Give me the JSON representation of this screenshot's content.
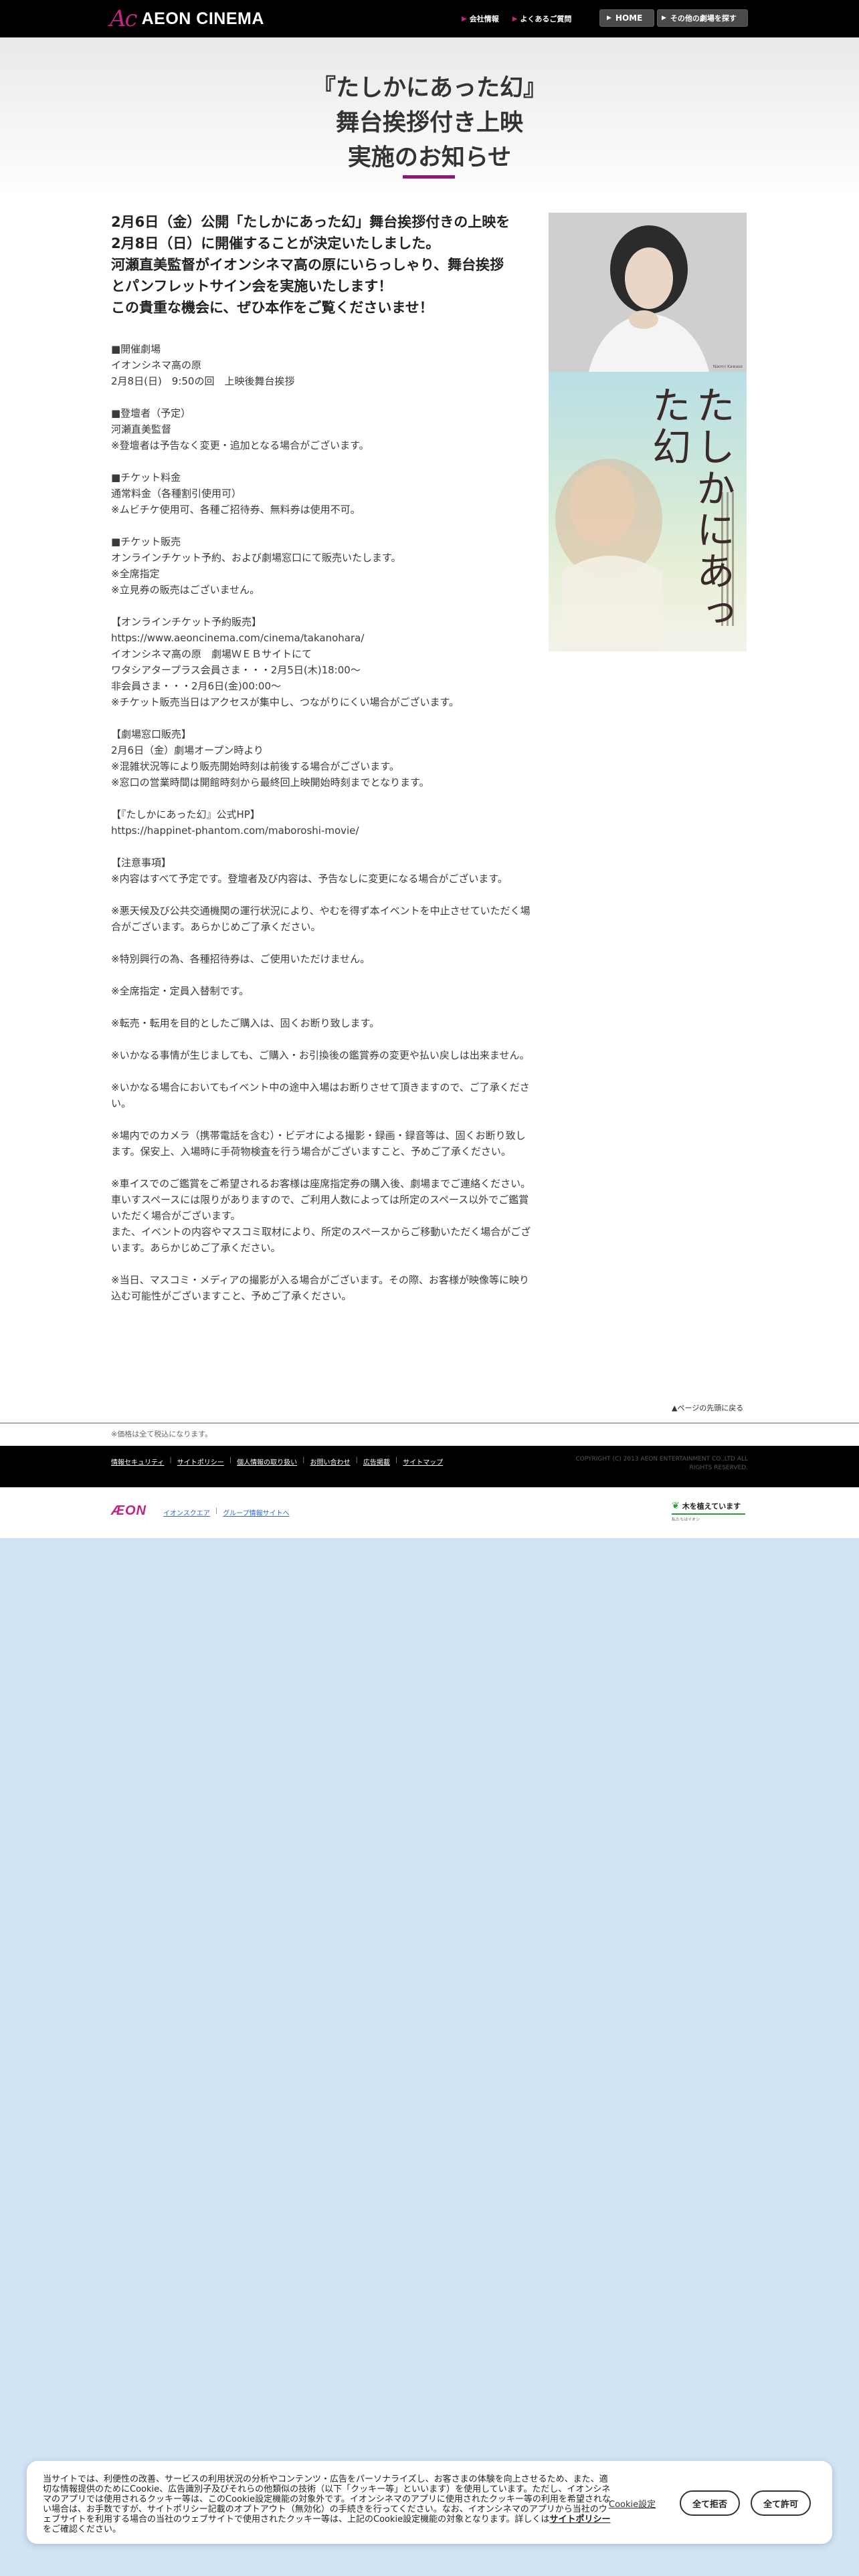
{
  "header": {
    "logo_mark": "Ac",
    "logo_text": "AEON CINEMA",
    "links": [
      "会社情報",
      "よくあるご質問"
    ],
    "home_label": "HOME",
    "other_theaters_label": "その他の劇場を探す"
  },
  "title_lines": [
    "『たしかにあった幻』",
    "舞台挨拶付き上映",
    "実施のお知らせ"
  ],
  "lead_lines": [
    "2月6日（金）公開「たしかにあった幻」舞台挨拶付きの上映を",
    "2月8日（日）に開催することが決定いたしました。",
    "河瀬直美監督がイオンシネマ高の原にいらっしゃり、舞台挨拶",
    "とパンフレットサイン会を実施いたします！",
    "この貴重な機会に、ぜひ本作をご覧くださいませ！"
  ],
  "body_lines": [
    "■開催劇場",
    "イオンシネマ高の原",
    "2月8日(日)　9:50の回　上映後舞台挨拶",
    "",
    "■登壇者（予定）",
    "河瀬直美監督",
    "※登壇者は予告なく変更・追加となる場合がございます。",
    "",
    "■チケット料金",
    "通常料金（各種割引使用可）",
    "※ムビチケ使用可、各種ご招待券、無料券は使用不可。",
    "",
    "■チケット販売",
    "オンラインチケット予約、および劇場窓口にて販売いたします。",
    "※全席指定",
    "※立見券の販売はございません。",
    "",
    "【オンラインチケット予約販売】",
    "https://www.aeoncinema.com/cinema/takanohara/",
    "イオンシネマ高の原　劇場ＷＥＢサイトにて",
    "ワタシアタープラス会員さま・・・2月5日(木)18:00〜",
    "非会員さま・・・2月6日(金)00:00〜",
    "※チケット販売当日はアクセスが集中し、つながりにくい場合がございます。",
    "",
    "【劇場窓口販売】",
    "2月6日（金）劇場オープン時より",
    "※混雑状況等により販売開始時刻は前後する場合がございます。",
    "※窓口の営業時間は開館時刻から最終回上映開始時刻までとなります。",
    "",
    "【『たしかにあった幻』公式HP】",
    "https://happinet-phantom.com/maboroshi-movie/",
    "",
    "【注意事項】"
  ],
  "notice_items": [
    "※内容はすべて予定です。登壇者及び内容は、予告なしに変更になる場合がございます。",
    "※悪天候及び公共交通機関の運行状況により、やむを得ず本イベントを中止させていただく場合がございます。あらかじめご了承ください。",
    "※特別興行の為、各種招待券は、ご使用いただけません。",
    "※全席指定・定員入替制です。",
    "※転売・転用を目的としたご購入は、固くお断り致します。",
    "※いかなる事情が生じましても、ご購入・お引換後の鑑賞券の変更や払い戻しは出来ません。",
    "※いかなる場合においてもイベント中の途中入場はお断りさせて頂きますので、ご了承ください。",
    "※場内でのカメラ（携帯電話を含む）・ビデオによる撮影・録画・録音等は、固くお断り致します。保安上、入場時に手荷物検査を行う場合がございますこと、予めご了承ください。",
    "※車イスでのご鑑賞をご希望されるお客様は座席指定券の購入後、劇場までご連絡ください。\n車いすスペースには限りがありますので、ご利用人数によっては所定のスペース以外でご鑑賞いただく場合がございます。\nまた、イベントの内容やマスコミ取材により、所定のスペースからご移動いただく場合がございます。あらかじめご了承ください。",
    "※当日、マスコミ・メディアの撮影が入る場合がございます。その際、お客様が映像等に映り込む可能性がございますこと、予めご了承ください。"
  ],
  "poster": {
    "title": "たしかにあった幻",
    "photo_caption": "Naomi Kawase"
  },
  "page_top_label": "▲ページの先頭に戻る",
  "price_note": "※価格は全て税込になります。",
  "footer": {
    "links": [
      "情報セキュリティ",
      "サイトポリシー",
      "個人情報の取り扱い",
      "お問い合わせ",
      "広告掲載",
      "サイトマップ"
    ],
    "copyright": "COPYRIGHT (C) 2013 AEON ENTERTAINMENT CO.,LTD ALL RIGHTS RESERVED."
  },
  "aeon": {
    "logo": "ÆON",
    "links": [
      "イオンスクエア",
      "グループ情報サイトへ"
    ],
    "badge_text": "木を植えています",
    "badge_sub": "私たちはイオン"
  },
  "cookie": {
    "text": "当サイトでは、利便性の改善、サービスの利用状況の分析やコンテンツ・広告をパーソナライズし、お客さまの体験を向上させるため、また、適切な情報提供のためにCookie、広告識別子及びそれらの他類似の技術（以下「クッキー等」といいます）を使用しています。ただし、イオンシネマのアプリでは使用されるクッキー等は、このCookie設定機能の対象外です。イオンシネマのアプリに使用されたクッキー等の利用を希望されない場合は、お手数ですが、サイトポリシー記載のオプトアウト（無効化）の手続きを行ってください。なお、イオンシネマのアプリから当社のウェブサイトを利用する場合の当社のウェブサイトで使用されたクッキー等は、上記のCookie設定機能の対象となります。詳しくは",
    "policy_link": "サイトポリシー",
    "text_end": "をご確認ください。",
    "settings_label": "Cookie設定",
    "reject_label": "全て拒否",
    "accept_label": "全て許可"
  }
}
